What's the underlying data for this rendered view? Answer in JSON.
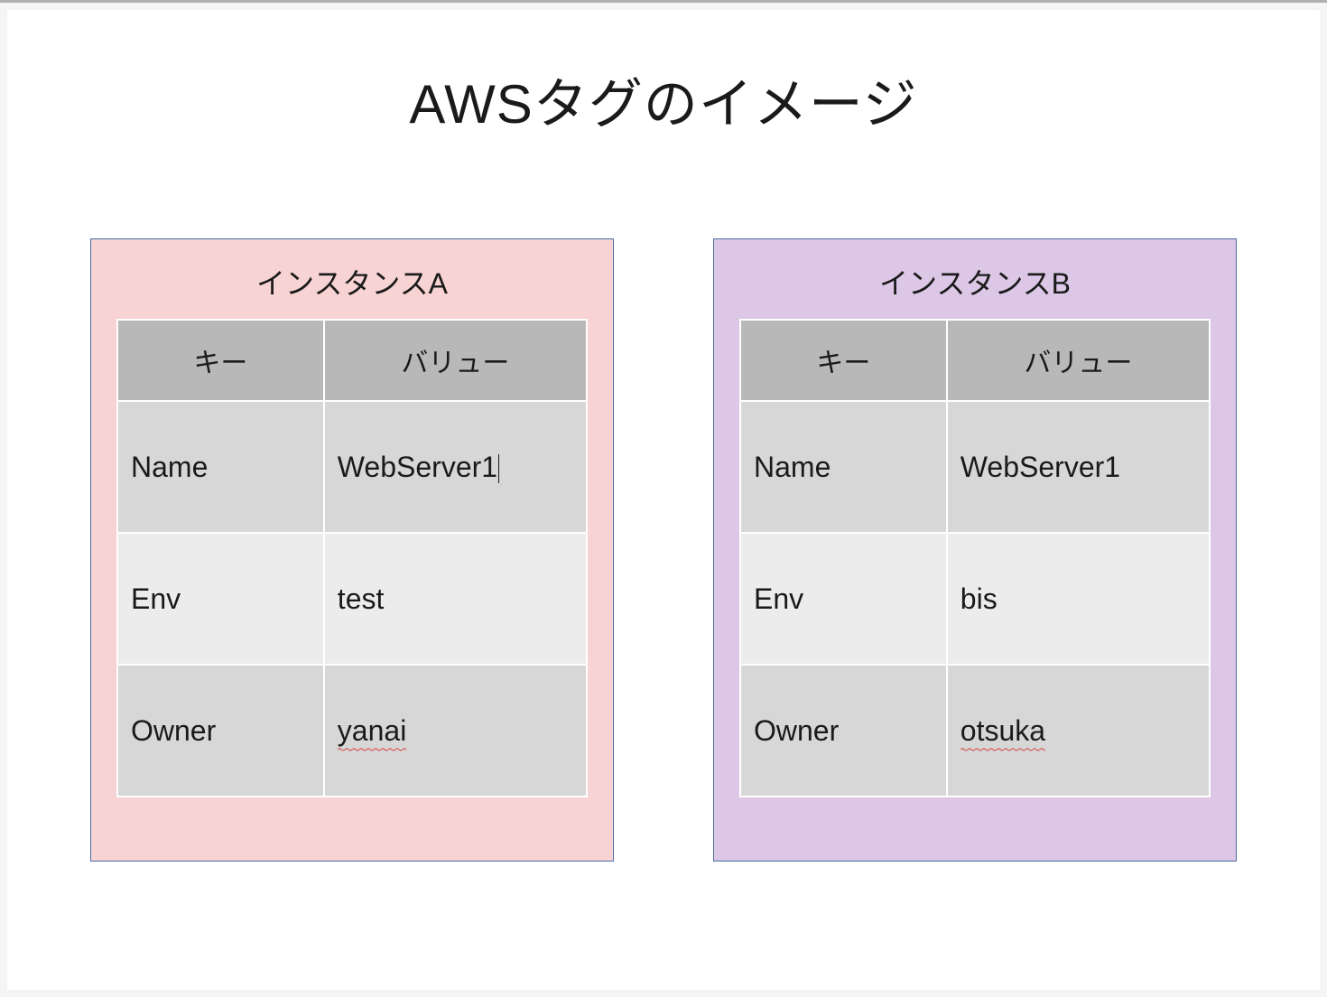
{
  "title": "AWSタグのイメージ",
  "instances": {
    "a": {
      "label": "インスタンスA",
      "headers": {
        "key": "キー",
        "value": "バリュー"
      },
      "rows": [
        {
          "key": "Name",
          "value": "WebServer1",
          "value_caret": true
        },
        {
          "key": "Env",
          "value": "test"
        },
        {
          "key": "Owner",
          "value": "yanai",
          "value_squiggle": true
        }
      ]
    },
    "b": {
      "label": "インスタンスB",
      "headers": {
        "key": "キー",
        "value": "バリュー"
      },
      "rows": [
        {
          "key": "Name",
          "value": "WebServer1"
        },
        {
          "key": "Env",
          "value": "bis"
        },
        {
          "key": "Owner",
          "value": "otsuka",
          "value_squiggle": true
        }
      ]
    }
  }
}
